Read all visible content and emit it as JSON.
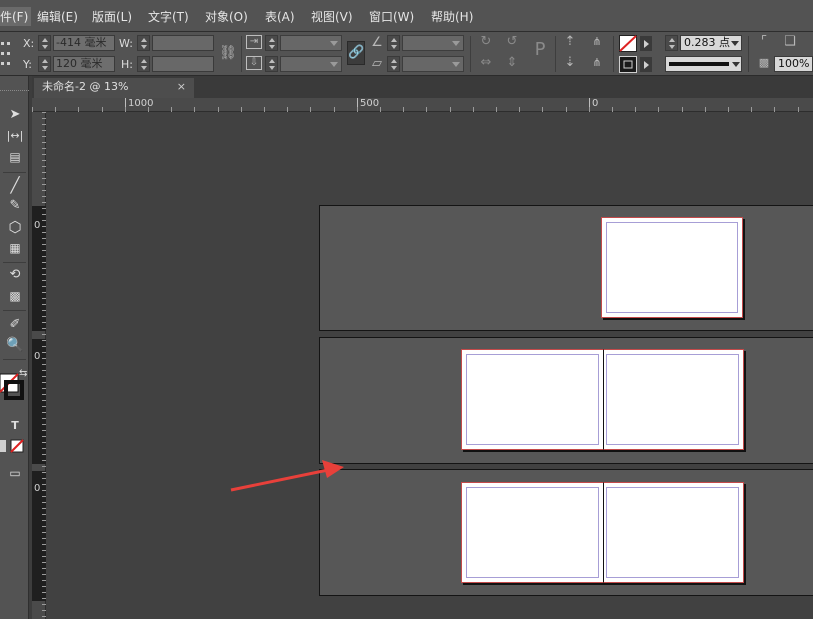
{
  "menubar": {
    "items": [
      {
        "label": "件(F)"
      },
      {
        "label": "编辑(E)"
      },
      {
        "label": "版面(L)"
      },
      {
        "label": "文字(T)"
      },
      {
        "label": "对象(O)"
      },
      {
        "label": "表(A)"
      },
      {
        "label": "视图(V)"
      },
      {
        "label": "窗口(W)"
      },
      {
        "label": "帮助(H)"
      }
    ]
  },
  "controlbar": {
    "x_label": "X:",
    "x_value": "-414 毫米",
    "y_label": "Y:",
    "y_value": "120 毫米",
    "w_label": "W:",
    "h_label": "H:",
    "stroke_weight": "0.283 点",
    "zoom_value": "100%"
  },
  "document": {
    "tab_title": "未命名-2 @ 13%",
    "close_glyph": "×"
  },
  "ruler": {
    "h_labels": [
      "1000",
      "500",
      "0"
    ],
    "v_labels": [
      "0",
      "0",
      "0"
    ]
  },
  "icons": {
    "selection": "selection-tool-icon",
    "gap": "gap-tool-icon",
    "content_collector": "content-collector-icon",
    "line": "line-tool-icon",
    "pen": "pen-tool-icon",
    "polygon": "polygon-frame-icon",
    "table": "table-tool-icon",
    "rotate": "rotate-tool-icon",
    "gradient": "gradient-swatch-icon",
    "eyedropper": "eyedropper-icon",
    "zoom": "zoom-icon",
    "type": "type-tool-icon"
  },
  "toolbar": {
    "type_glyph": "T"
  },
  "colors": {
    "annotation_arrow": "#e8403a",
    "page_border": "#c44a4a",
    "margin_guide": "#a79ed6"
  }
}
